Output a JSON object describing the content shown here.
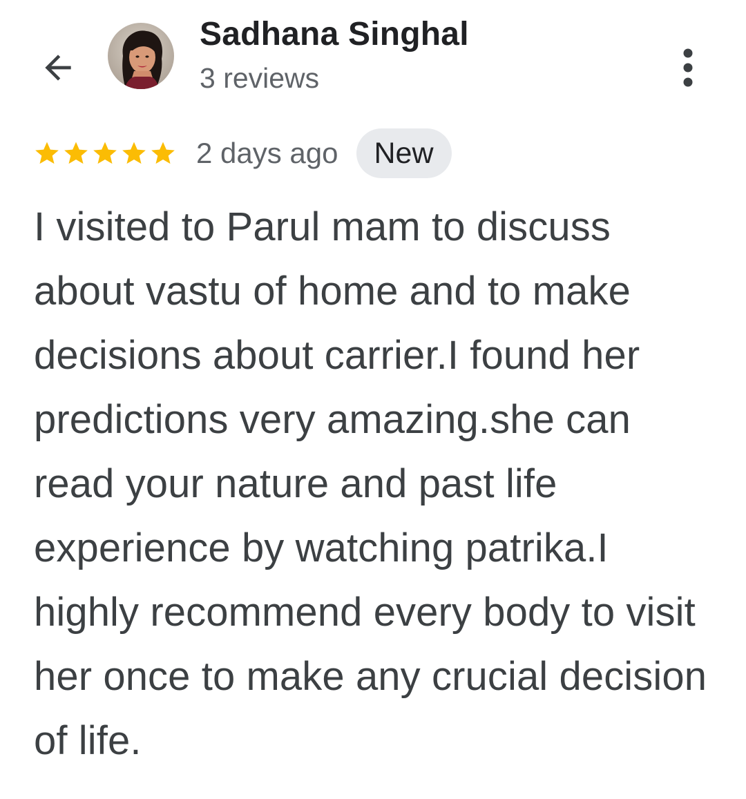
{
  "header": {
    "back_icon": "arrow-back-icon",
    "avatar_icon": "profile-photo",
    "user_name": "Sadhana Singhal",
    "review_count": "3 reviews",
    "more_icon": "more-vertical-icon"
  },
  "review": {
    "rating": 5,
    "rating_max": 5,
    "star_color": "#fbbc04",
    "time_ago": "2 days ago",
    "badge": "New",
    "text": "I visited to Parul mam to discuss about vastu of home and to make decisions about carrier.I found her predictions very amazing.she can read your nature and past life experience by watching patrika.I highly recommend every body to visit her once to make any crucial decision of life."
  },
  "colors": {
    "name_text": "#202124",
    "secondary_text": "#5f6368",
    "body_text": "#3c4043",
    "badge_bg": "#e8eaed"
  }
}
